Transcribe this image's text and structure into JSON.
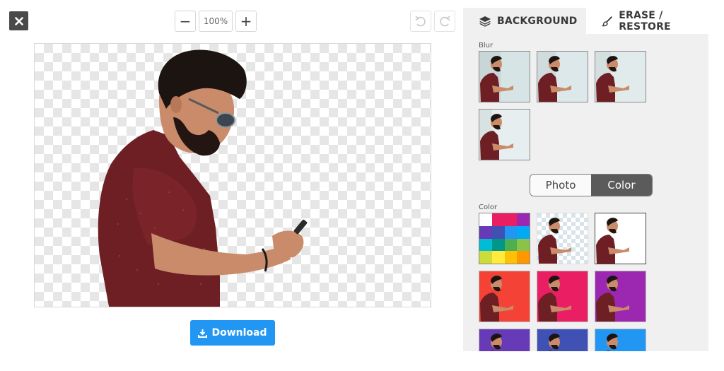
{
  "toolbar": {
    "zoom_level": "100%",
    "zoom_out_label": "−",
    "zoom_in_label": "+"
  },
  "download": {
    "label": "Download"
  },
  "panel": {
    "tabs": [
      {
        "label": "BACKGROUND",
        "icon": "layers-icon",
        "active": true
      },
      {
        "label": "ERASE / RESTORE",
        "icon": "brush-icon",
        "active": false
      }
    ],
    "blur_label": "Blur",
    "blur_thumbs": [
      "blur-1",
      "blur-2",
      "blur-3",
      "blur-4"
    ],
    "segment": {
      "photo": "Photo",
      "color": "Color",
      "selected": "Color"
    },
    "color_label": "Color",
    "color_swatches": [
      "#ffffff",
      "#e91e63",
      "#e91e63",
      "#9c27b0",
      "#673ab7",
      "#3f51b5",
      "#2196f3",
      "#03a9f4",
      "#00bcd4",
      "#009688",
      "#4caf50",
      "#8bc34a",
      "#cddc39",
      "#ffeb3b",
      "#ffc107",
      "#ff9800"
    ],
    "color_thumbs": [
      {
        "name": "transparent"
      },
      {
        "name": "white",
        "color": "#ffffff"
      },
      {
        "name": "red",
        "color": "#f44336"
      },
      {
        "name": "pink",
        "color": "#e91e63"
      },
      {
        "name": "purple",
        "color": "#9c27b0"
      },
      {
        "name": "deep-purple",
        "color": "#673ab7"
      },
      {
        "name": "indigo",
        "color": "#3f51b5"
      },
      {
        "name": "blue",
        "color": "#2196f3"
      }
    ]
  }
}
